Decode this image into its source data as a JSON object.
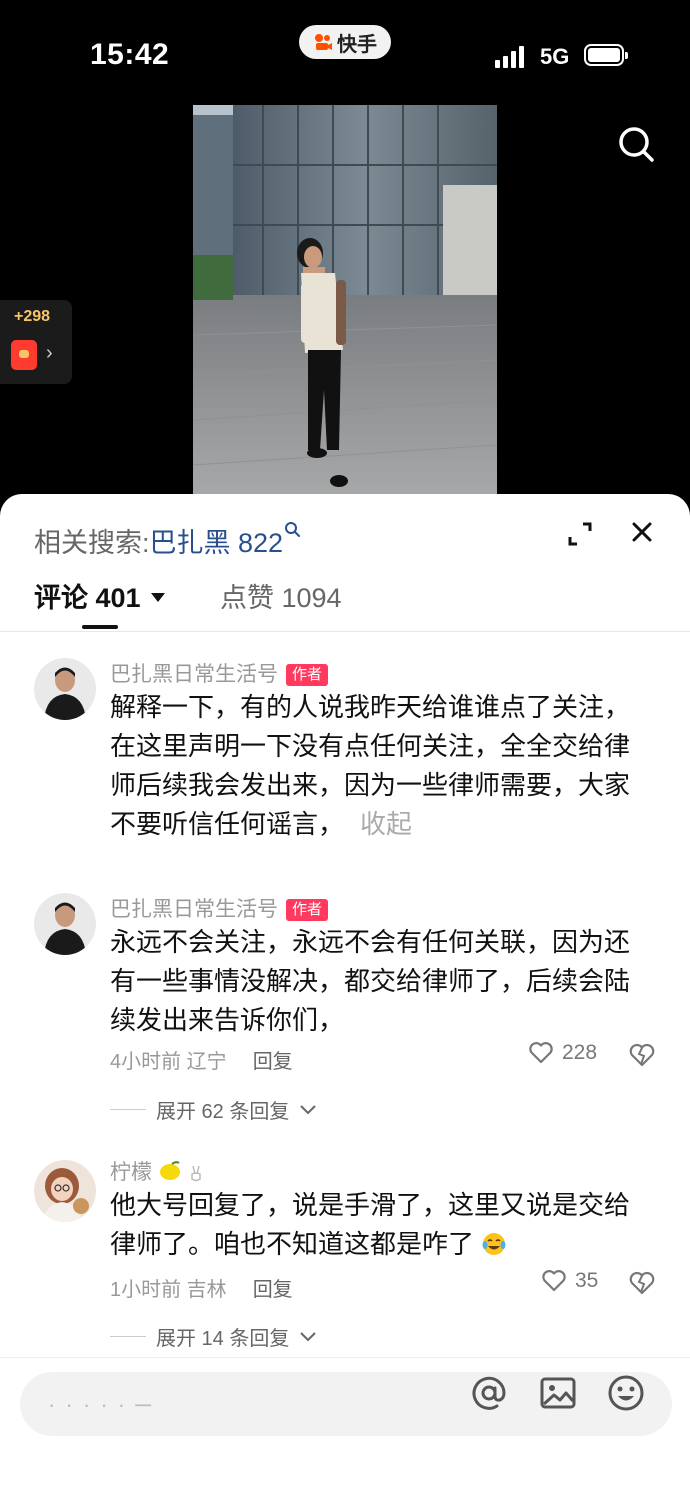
{
  "status_bar": {
    "time": "15:42",
    "app_name": "快手",
    "network": "5G"
  },
  "video": {
    "description_icons": [
      "search-icon"
    ]
  },
  "red_packet": {
    "amount": "+298"
  },
  "sheet": {
    "related_label": "相关搜索:",
    "related_keyword": "巴扎黑 822",
    "tabs": {
      "comments_label": "评论 401",
      "likes_label": "点赞 1094"
    }
  },
  "comments": [
    {
      "author": "巴扎黑日常生活号",
      "badge": "作者",
      "text": "解释一下，有的人说我昨天给谁谁点了关注，在这里声明一下没有点任何关注，全全交给律师后续我会发出来，因为一些律师需要，大家不要听信任何谣言，",
      "fold_label": "收起"
    },
    {
      "author": "巴扎黑日常生活号",
      "badge": "作者",
      "text": "永远不会关注，永远不会有任何关联，因为还有一些事情没解决，都交给律师了，后续会陆续发出来告诉你们，",
      "time_location": "4小时前 辽宁",
      "reply_label": "回复",
      "likes": "228",
      "expand_label": "展开 62 条回复"
    },
    {
      "author": "柠檬",
      "text": "他大号回复了，说是手滑了，这里又说是交给律师了。咱也不知道这都是咋了",
      "time_location": "1小时前 吉林",
      "reply_label": "回复",
      "likes": "35",
      "expand_label": "展开 14 条回复"
    }
  ],
  "input": {
    "placeholder": "·  ·  ·  ·  · ─"
  }
}
